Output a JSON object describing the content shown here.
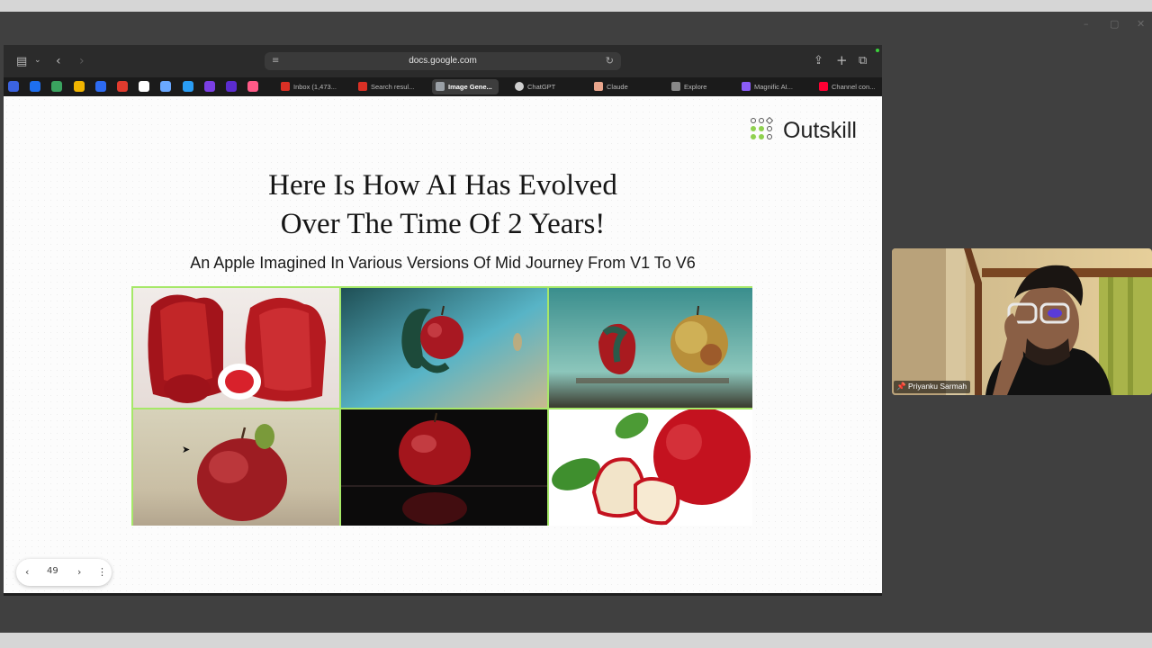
{
  "browser": {
    "url": "docs.google.com",
    "tabs": [
      {
        "label": "Inbox (1,473...",
        "favicon_color": "#d93025",
        "active": false
      },
      {
        "label": "Search resul...",
        "favicon_color": "#d93025",
        "active": false
      },
      {
        "label": "Image Gene...",
        "favicon_color": "#9aa0a6",
        "active": true
      },
      {
        "label": "ChatGPT",
        "favicon_color": "#cfcfcf",
        "active": false
      },
      {
        "label": "Claude",
        "favicon_color": "#e8a58c",
        "active": false
      },
      {
        "label": "Explore",
        "favicon_color": "#888888",
        "active": false
      },
      {
        "label": "Magnific AI...",
        "favicon_color": "#8a5cf6",
        "active": false
      },
      {
        "label": "Channel con...",
        "favicon_color": "#ff0033",
        "active": false
      }
    ],
    "pinned_colors": [
      "#3b63e0",
      "#1e6ff0",
      "#3aa35f",
      "#f0b400",
      "#2d6bf2",
      "#e23b2e",
      "#ffffff",
      "#6aa8ff",
      "#2a9df4",
      "#7b3fe4",
      "#5b2ccf",
      "#ff5a87"
    ]
  },
  "slide": {
    "logo_text": "Outskill",
    "title_line1": "Here Is How AI Has Evolved",
    "title_line2": "Over The Time Of 2 Years!",
    "subtitle": "An Apple Imagined In Various Versions Of Mid Journey From V1 To V6",
    "page_number": "49"
  },
  "video": {
    "participant_name": "Priyanku Sarmah"
  },
  "colors": {
    "accent_border": "#a6e868",
    "logo_green": "#8fd14f"
  }
}
